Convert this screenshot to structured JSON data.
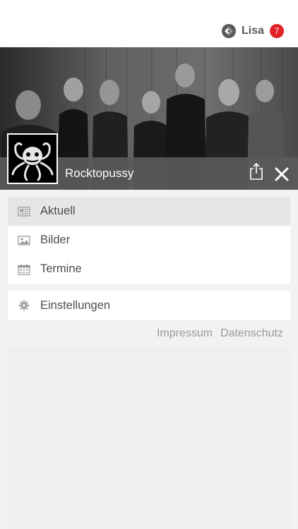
{
  "header": {
    "user_name": "Lisa",
    "notification_count": "7",
    "logo_icon": "app-logo-icon"
  },
  "band": {
    "name": "Rocktopussy"
  },
  "menu": {
    "items": [
      {
        "label": "Aktuell",
        "icon": "newspaper-icon",
        "active": true
      },
      {
        "label": "Bilder",
        "icon": "image-icon",
        "active": false
      },
      {
        "label": "Termine",
        "icon": "calendar-icon",
        "active": false
      }
    ]
  },
  "settings": {
    "label": "Einstellungen",
    "icon": "gear-icon"
  },
  "footer": {
    "impressum": "Impressum",
    "datenschutz": "Datenschutz"
  },
  "colors": {
    "badge": "#e02127",
    "band_bar": "#5a5a5a",
    "active_item": "#e6e6e6",
    "background": "#f2f2f2"
  }
}
